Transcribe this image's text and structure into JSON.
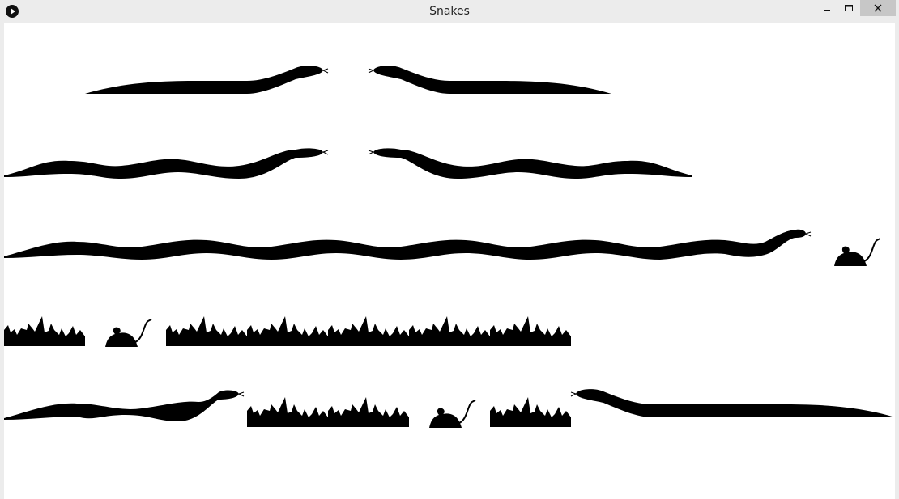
{
  "window": {
    "title": "Snakes",
    "icon": "play-circle-icon",
    "controls": [
      "minimize-icon",
      "maximize-icon",
      "close-icon"
    ]
  },
  "scene": {
    "background": "#ffffff",
    "fill": "#000000",
    "elements": [
      "snake",
      "snake",
      "snake",
      "snake",
      "snake",
      "mouse",
      "grass",
      "mouse",
      "grass",
      "snake",
      "grass",
      "mouse",
      "grass",
      "snake"
    ]
  }
}
